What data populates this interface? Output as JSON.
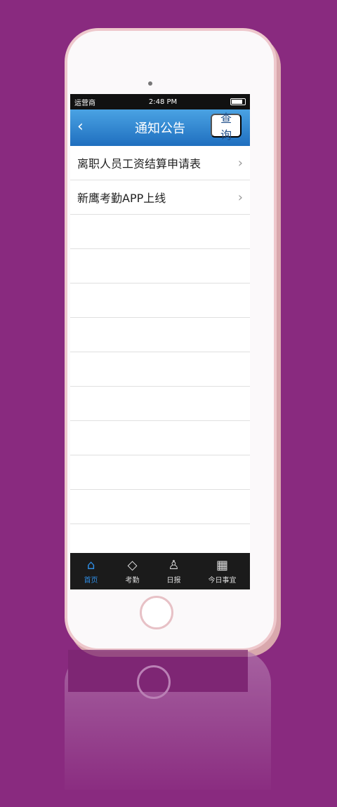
{
  "status": {
    "carrier": "运营商",
    "time": "2:48 PM"
  },
  "nav": {
    "title": "通知公告",
    "back_icon": "chevron-left-icon",
    "query_label": "查询"
  },
  "notices": [
    {
      "title": "离职人员工资结算申请表"
    },
    {
      "title": "新鹰考勤APP上线"
    },
    {
      "title": ""
    },
    {
      "title": ""
    },
    {
      "title": ""
    },
    {
      "title": ""
    },
    {
      "title": ""
    },
    {
      "title": ""
    },
    {
      "title": ""
    },
    {
      "title": ""
    },
    {
      "title": ""
    },
    {
      "title": ""
    }
  ],
  "tabs": [
    {
      "label": "首页",
      "icon": "home-icon",
      "active": true
    },
    {
      "label": "考勤",
      "icon": "tag-icon"
    },
    {
      "label": "日报",
      "icon": "user-icon"
    },
    {
      "label": "今日事宜",
      "icon": "grid-icon"
    }
  ],
  "colors": {
    "background": "#892A7F",
    "nav": "#2E86D6",
    "tabbar": "#1B1B1B",
    "active_tab": "#2F8DE3"
  }
}
